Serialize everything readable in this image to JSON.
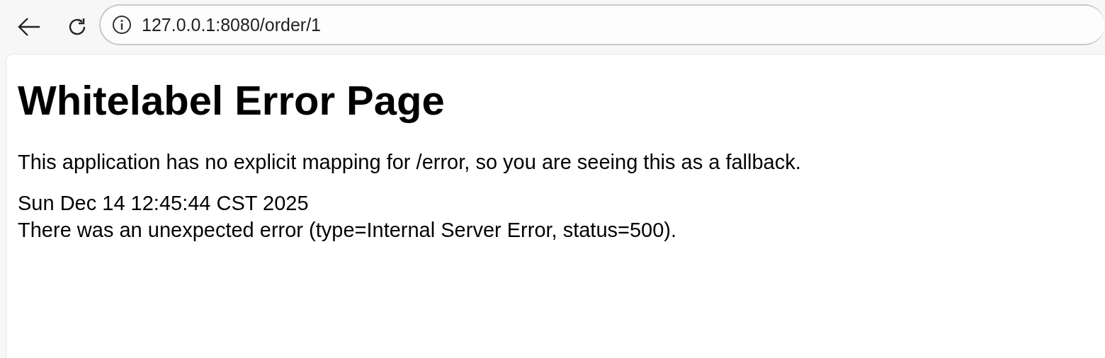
{
  "browser": {
    "url": "127.0.0.1:8080/order/1"
  },
  "page": {
    "title": "Whitelabel Error Page",
    "message": "This application has no explicit mapping for /error, so you are seeing this as a fallback.",
    "lines": [
      "Sun Dec 14 12:45:44 CST 2025",
      "There was an unexpected error (type=Internal Server Error, status=500)."
    ]
  }
}
